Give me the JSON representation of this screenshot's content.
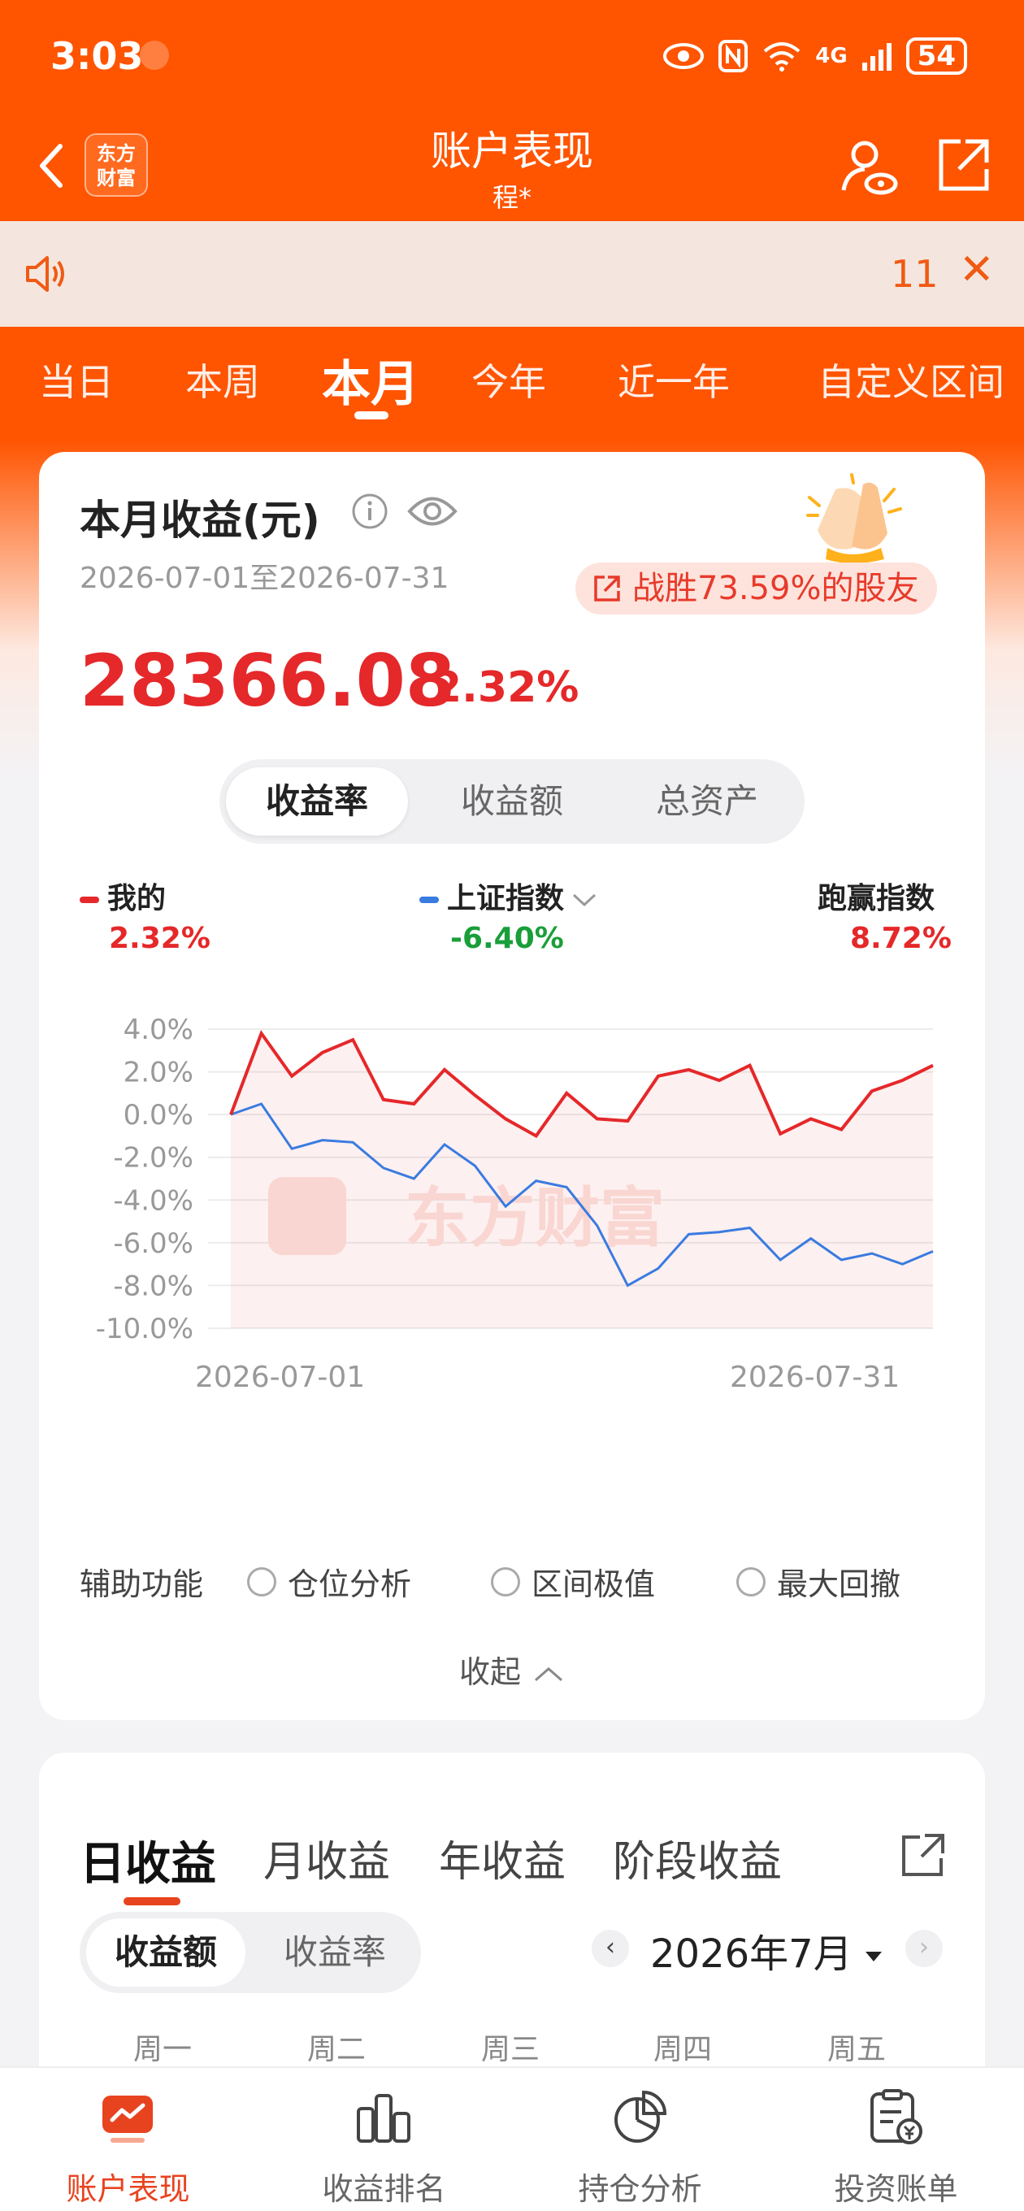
{
  "status": {
    "time": "3:03",
    "battery": "54",
    "signal": "4G"
  },
  "nav": {
    "title": "账户表现",
    "subtitle": "程*",
    "logo": "东方\n财富"
  },
  "notice": {
    "count": "11",
    "close": "✕"
  },
  "period_tabs": [
    "当日",
    "本周",
    "本月",
    "今年",
    "近一年",
    "自定义区间"
  ],
  "period_active": "本月",
  "revenue": {
    "title": "本月收益(元)",
    "date_range": "2026-07-01至2026-07-31",
    "beat": "战胜73.59%的股友",
    "amount": "28366.08",
    "pct": "2.32%"
  },
  "segments": [
    "收益率",
    "收益额",
    "总资产"
  ],
  "legend": {
    "mine_label": "我的",
    "mine_value": "2.32%",
    "index_label": "上证指数",
    "index_value": "-6.40%",
    "beat_label": "跑赢指数",
    "beat_value": "8.72%"
  },
  "colors": {
    "accent": "#ff5400",
    "mine": "#e5282a",
    "index": "#3a7be0",
    "green": "#1a9e3a"
  },
  "chart_data": {
    "type": "line",
    "ylim": [
      -10,
      4
    ],
    "yticks": [
      "4.0%",
      "2.0%",
      "0.0%",
      "-2.0%",
      "-4.0%",
      "-6.0%",
      "-8.0%",
      "-10.0%"
    ],
    "x_start_label": "2026-07-01",
    "x_end_label": "2026-07-31",
    "watermark": "东方财富",
    "series": [
      {
        "name": "我的",
        "color": "#e5282a",
        "values": [
          0.0,
          3.8,
          1.8,
          2.9,
          3.5,
          0.7,
          0.5,
          2.1,
          0.9,
          -0.2,
          -1.0,
          1.0,
          -0.2,
          -0.3,
          1.8,
          2.1,
          1.6,
          2.3,
          -0.9,
          -0.2,
          -0.7,
          1.1,
          1.6,
          2.3
        ]
      },
      {
        "name": "上证指数",
        "color": "#3a7be0",
        "values": [
          0.0,
          0.5,
          -1.6,
          -1.2,
          -1.3,
          -2.5,
          -3.0,
          -1.4,
          -2.4,
          -4.3,
          -3.1,
          -3.4,
          -5.2,
          -8.0,
          -7.2,
          -5.6,
          -5.5,
          -5.3,
          -6.8,
          -5.8,
          -6.8,
          -6.5,
          -7.0,
          -6.4
        ]
      }
    ]
  },
  "aux": {
    "label": "辅助功能",
    "options": [
      "仓位分析",
      "区间极值",
      "最大回撤"
    ],
    "collapse": "收起"
  },
  "income_tabs": [
    "日收益",
    "月收益",
    "年收益",
    "阶段收益"
  ],
  "income_segments": [
    "收益额",
    "收益率"
  ],
  "month": {
    "label": "2026年7月",
    "prev": "‹",
    "next": "›"
  },
  "weekdays": [
    "周一",
    "周二",
    "周三",
    "周四",
    "周五"
  ],
  "bottom_nav": [
    "账户表现",
    "收益排名",
    "持仓分析",
    "投资账单"
  ]
}
